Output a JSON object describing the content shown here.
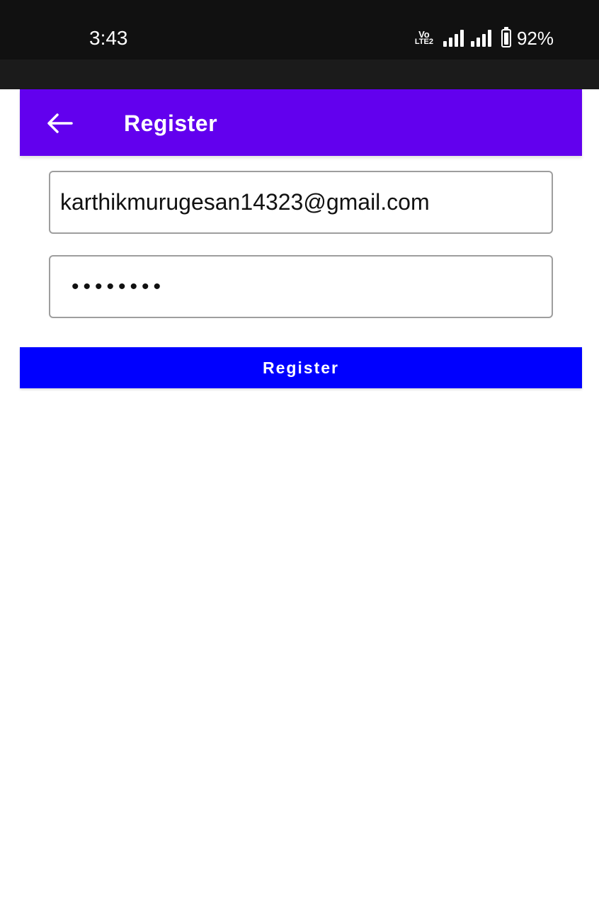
{
  "status_bar": {
    "time": "3:43",
    "network_label_top": "Vo",
    "network_label_bottom": "LTE2",
    "battery_percent_text": "92%",
    "battery_level": 0.92
  },
  "app_bar": {
    "title": "Register",
    "back_icon": "arrow-left-icon",
    "background_color": "#6200ee"
  },
  "form": {
    "email_value": "karthikmurugesan14323@gmail.com",
    "password_value": "12345678"
  },
  "register_button": {
    "label": "Register",
    "background_color": "#0000ff"
  }
}
